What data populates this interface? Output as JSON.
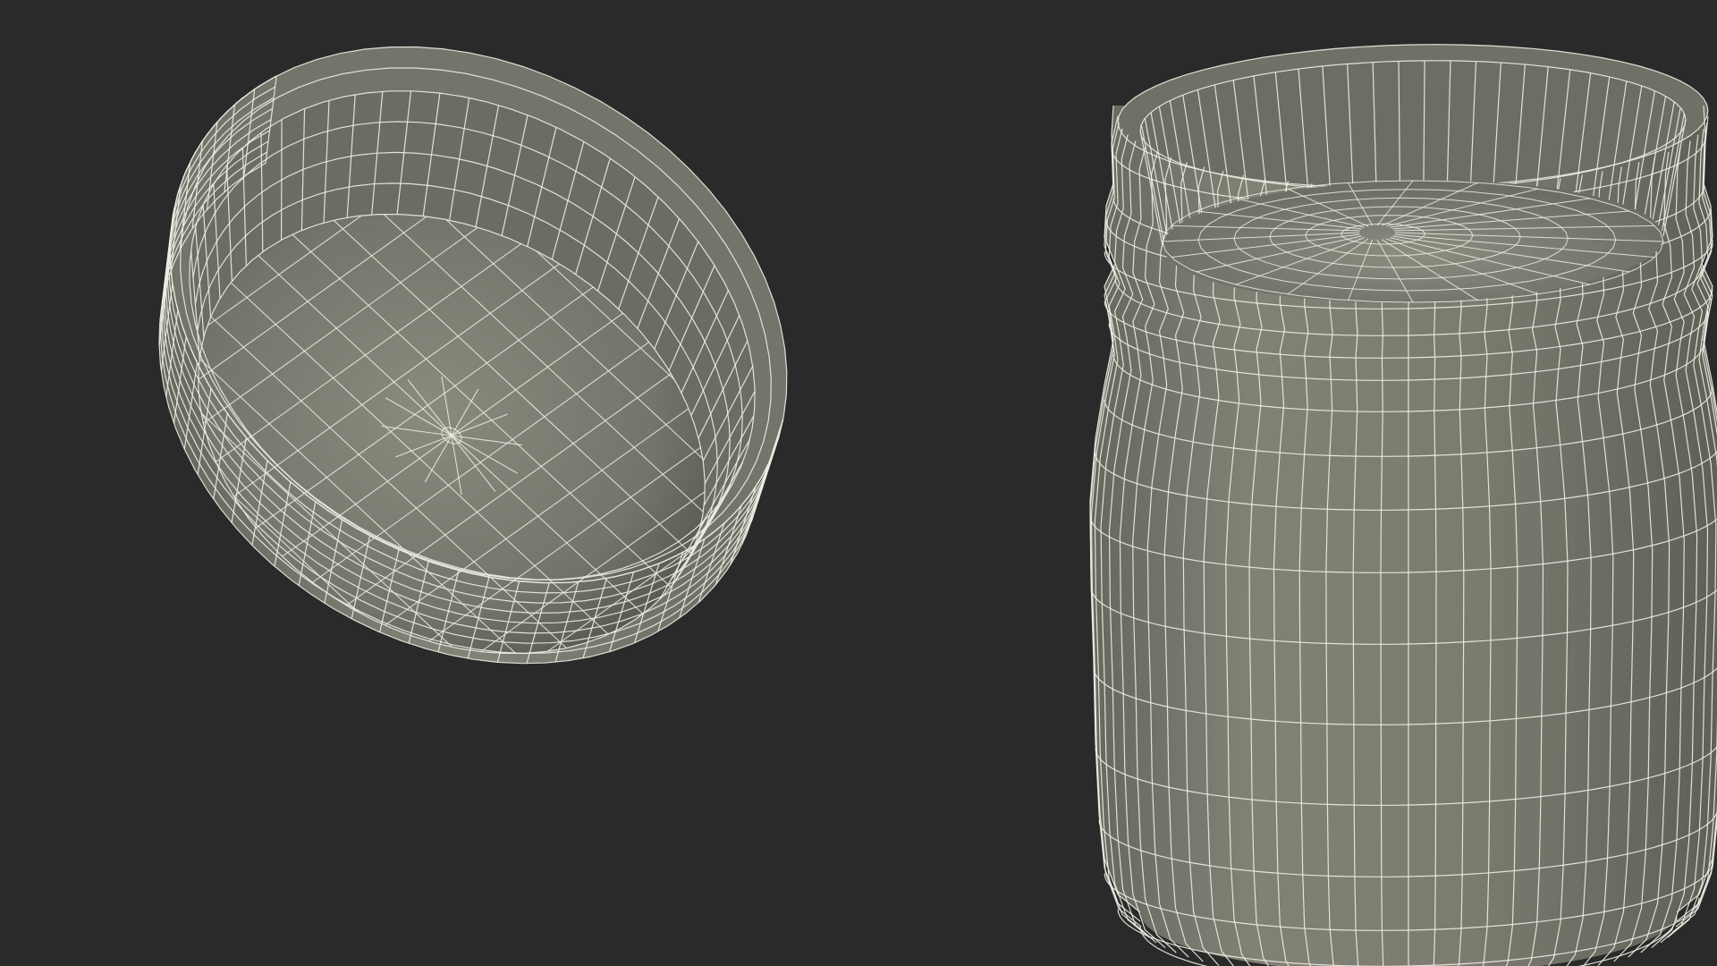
{
  "scene": {
    "background": "#2a2a2a",
    "surface_color": "#7e7f73",
    "surface_dark": "#5f6056",
    "surface_light": "#9a9b8f",
    "wire_color": "#eeeee4",
    "objects": [
      {
        "name": "jar-lid",
        "kind": "wireframe-cap",
        "orientation": "tilted-open-side-up"
      },
      {
        "name": "jar-body",
        "kind": "wireframe-jar",
        "orientation": "upright-open"
      }
    ]
  }
}
